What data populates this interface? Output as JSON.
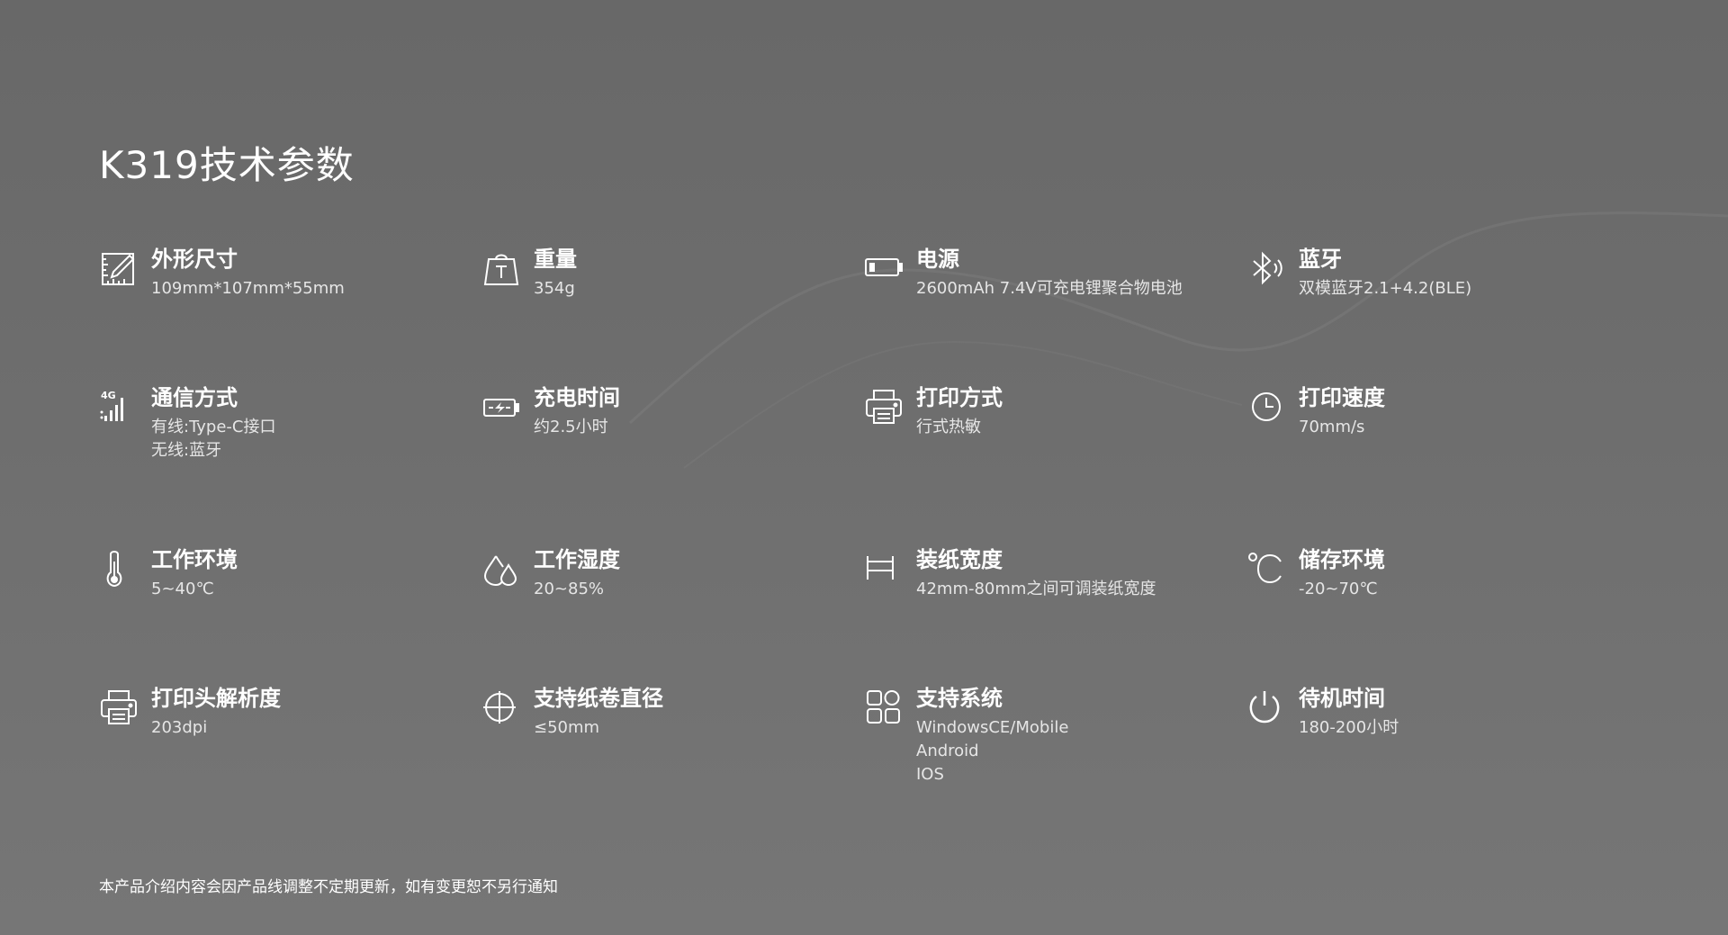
{
  "page": {
    "title": "K319技术参数",
    "footnote": "本产品介绍内容会因产品线调整不定期更新，如有变更恕不另行通知"
  },
  "specs": [
    {
      "icon": "dimensions-icon",
      "name": "外形尺寸",
      "values": [
        "109mm*107mm*55mm"
      ]
    },
    {
      "icon": "weight-icon",
      "name": "重量",
      "values": [
        "354g"
      ]
    },
    {
      "icon": "battery-icon",
      "name": "电源",
      "values": [
        "2600mAh 7.4V可充电锂聚合物电池"
      ]
    },
    {
      "icon": "bluetooth-icon",
      "name": "蓝牙",
      "values": [
        "双模蓝牙2.1+4.2(BLE)"
      ]
    },
    {
      "icon": "signal-4g-icon",
      "name": "通信方式",
      "values": [
        "有线:Type-C接口",
        "无线:蓝牙"
      ]
    },
    {
      "icon": "charging-icon",
      "name": "充电时间",
      "values": [
        "约2.5小时"
      ]
    },
    {
      "icon": "printer-icon",
      "name": "打印方式",
      "values": [
        "行式热敏"
      ]
    },
    {
      "icon": "clock-icon",
      "name": "打印速度",
      "values": [
        "70mm/s"
      ]
    },
    {
      "icon": "thermometer-icon",
      "name": "工作环境",
      "values": [
        "5~40℃"
      ]
    },
    {
      "icon": "water-drops-icon",
      "name": "工作湿度",
      "values": [
        "20~85%"
      ]
    },
    {
      "icon": "paper-width-icon",
      "name": "装纸宽度",
      "values": [
        "42mm-80mm之间可调装纸宽度"
      ]
    },
    {
      "icon": "celsius-icon",
      "name": "储存环境",
      "values": [
        "-20~70℃"
      ]
    },
    {
      "icon": "printer-icon",
      "name": "打印头解析度",
      "values": [
        "203dpi"
      ]
    },
    {
      "icon": "crosshair-icon",
      "name": "支持纸卷直径",
      "values": [
        "≤50mm"
      ]
    },
    {
      "icon": "apps-grid-icon",
      "name": "支持系统",
      "values": [
        "WindowsCE/Mobile",
        "Android",
        "IOS"
      ]
    },
    {
      "icon": "power-icon",
      "name": "待机时间",
      "values": [
        "180-200小时"
      ]
    }
  ]
}
